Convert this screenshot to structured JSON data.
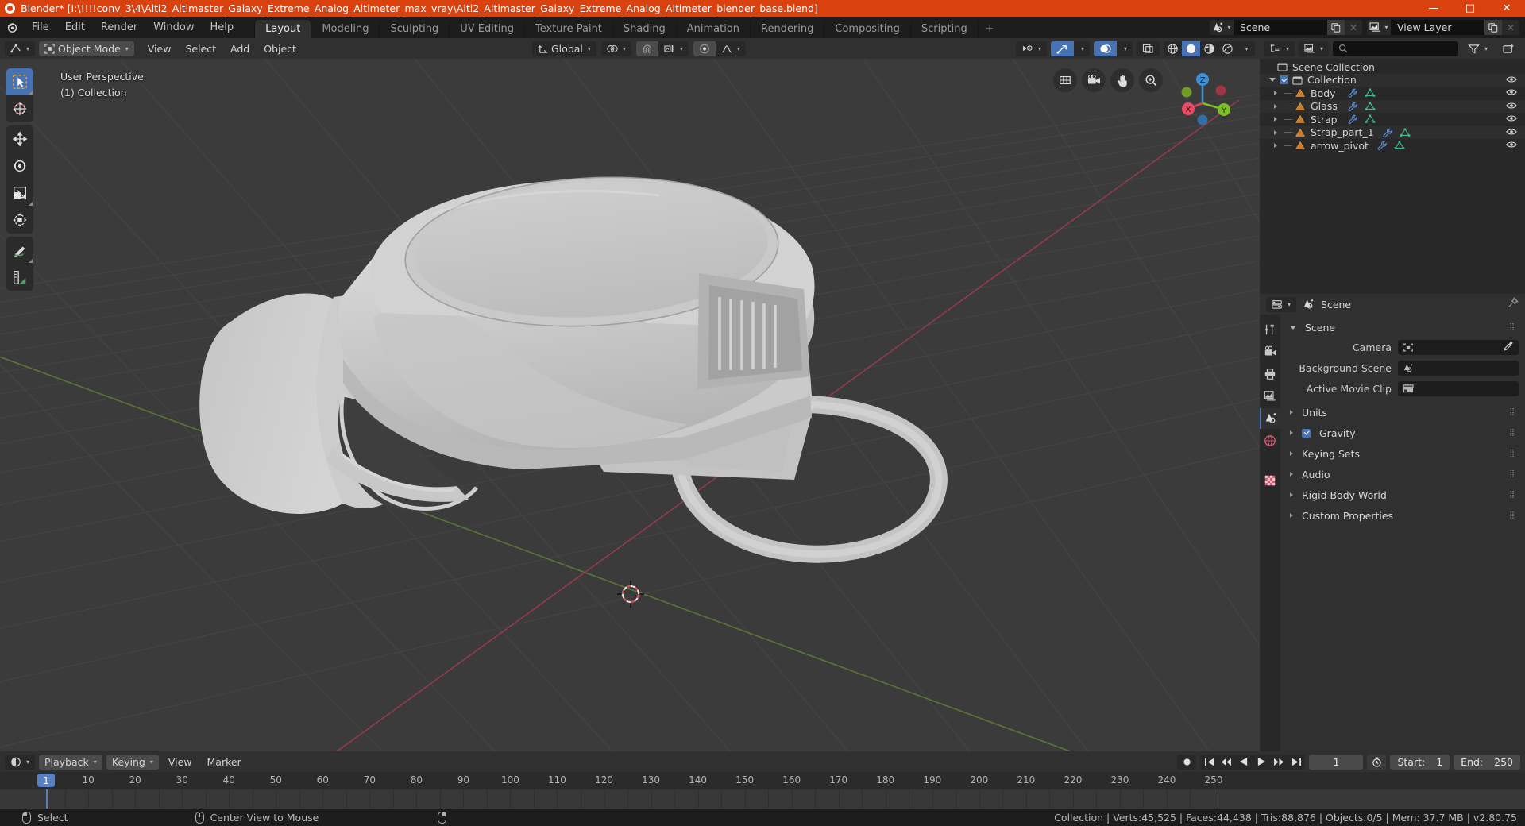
{
  "window": {
    "title": "Blender* [I:\\!!!!conv_3\\4\\Alti2_Altimaster_Galaxy_Extreme_Analog_Altimeter_max_vray\\Alti2_Altimaster_Galaxy_Extreme_Analog_Altimeter_blender_base.blend]",
    "minimize": "—",
    "maximize": "□",
    "close": "✕",
    "accent_color": "#d9410f"
  },
  "menus": [
    "File",
    "Edit",
    "Render",
    "Window",
    "Help"
  ],
  "workspaces": {
    "tabs": [
      "Layout",
      "Modeling",
      "Sculpting",
      "UV Editing",
      "Texture Paint",
      "Shading",
      "Animation",
      "Rendering",
      "Compositing",
      "Scripting"
    ],
    "active": "Layout",
    "add_label": "+"
  },
  "topbar_right": {
    "scene_name": "Scene",
    "view_layer_name": "View Layer",
    "scene_icon": "scene-data-icon",
    "view_layer_icon": "view-layer-icon",
    "copy_icon": "new-copy-icon",
    "close_icon": "x-icon"
  },
  "viewport_header": {
    "editor_type_icon": "editor-type-3dview-icon",
    "mode": "Object Mode",
    "mode_icon": "object-mode-icon",
    "menus": [
      "View",
      "Select",
      "Add",
      "Object"
    ],
    "transform_orientation": "Global",
    "transform_icon": "orientation-axis-icon",
    "snap_icon": "magnet-icon",
    "pivot_icon": "pivot-point-icon",
    "snap_target_icon": "snap-increment-icon",
    "proportional_icon": "proportional-edit-icon",
    "falloff_icon": "smooth-falloff-icon",
    "visibility_icon": "object-types-visibility-icon",
    "gizmo_icon": "gizmo-icon",
    "overlays_icon": "overlays-icon",
    "xray_icon": "toggle-xray-icon",
    "shading_modes": [
      "wireframe",
      "solid",
      "material-preview",
      "rendered"
    ],
    "shading_active": "solid"
  },
  "viewport": {
    "perspective_label": "User Perspective",
    "collection_label": "(1) Collection",
    "background_color": "#3b3b3b",
    "grid_color": "#4a4a4a",
    "x_axis_color": "#9c3a4a",
    "y_axis_color": "#5a7a35",
    "object_color": "#c9c9c9",
    "tools": [
      {
        "name": "tweak-select-box-tool",
        "active": true
      },
      {
        "name": "cursor-tool",
        "active": false
      },
      {
        "name": "move-tool",
        "active": false
      },
      {
        "name": "rotate-tool",
        "active": false
      },
      {
        "name": "scale-tool",
        "active": false
      },
      {
        "name": "transform-tool",
        "active": false
      },
      {
        "name": "annotate-tool",
        "active": false
      },
      {
        "name": "measure-tool",
        "active": false
      }
    ],
    "nav_buttons": [
      "zoom-region-icon",
      "camera-view-icon",
      "pan-view-icon",
      "zoom-view-icon"
    ],
    "gizmo_axes": [
      "Z",
      "Y",
      "X"
    ]
  },
  "outliner": {
    "display_mode_icon": "outliner-display-mode-icon",
    "filter_id_icon": "filter-id-icon",
    "search_placeholder": "",
    "search_icon": "search-icon",
    "filter_icon": "funnel-icon",
    "new_collection_icon": "new-collection-icon",
    "rows": [
      {
        "label": "Scene Collection",
        "icon": "collection-icon",
        "level": 0,
        "expander": "none",
        "checkbox": false,
        "eye": false,
        "modifier": false,
        "mesh": false
      },
      {
        "label": "Collection",
        "icon": "collection-icon",
        "level": 1,
        "expander": "down",
        "checkbox": true,
        "eye": true,
        "modifier": false,
        "mesh": false
      },
      {
        "label": "Body",
        "icon": "object-mesh-icon",
        "level": 2,
        "expander": "right",
        "checkbox": false,
        "eye": true,
        "modifier": true,
        "mesh": true
      },
      {
        "label": "Glass",
        "icon": "object-mesh-icon",
        "level": 2,
        "expander": "right",
        "checkbox": false,
        "eye": true,
        "modifier": true,
        "mesh": true
      },
      {
        "label": "Strap",
        "icon": "object-mesh-icon",
        "level": 2,
        "expander": "right",
        "checkbox": false,
        "eye": true,
        "modifier": true,
        "mesh": true
      },
      {
        "label": "Strap_part_1",
        "icon": "object-mesh-icon",
        "level": 2,
        "expander": "right",
        "checkbox": false,
        "eye": true,
        "modifier": true,
        "mesh": true
      },
      {
        "label": "arrow_pivot",
        "icon": "object-mesh-icon",
        "level": 2,
        "expander": "right",
        "checkbox": false,
        "eye": true,
        "modifier": true,
        "mesh": true
      }
    ]
  },
  "properties": {
    "editor_icon": "properties-editor-icon",
    "breadcrumb": "Scene",
    "breadcrumb_icon": "scene-properties-icon",
    "pin_icon": "pin-icon",
    "tabs": [
      {
        "name": "tool-tab",
        "icon": "tool-icon",
        "active": false
      },
      {
        "name": "render-tab",
        "icon": "render-camera-icon",
        "active": false
      },
      {
        "name": "output-tab",
        "icon": "printer-icon",
        "active": false
      },
      {
        "name": "view-layer-tab",
        "icon": "images-icon",
        "active": false
      },
      {
        "name": "scene-tab",
        "icon": "scene-cone-icon",
        "active": true
      },
      {
        "name": "world-tab",
        "icon": "world-globe-icon",
        "active": false
      },
      {
        "name": "texture-tab",
        "icon": "checker-texture-icon",
        "active": false
      }
    ],
    "panel_title": "Scene",
    "fields": [
      {
        "label": "Camera",
        "value": "",
        "icon": "camera-data-icon",
        "eyedropper": true
      },
      {
        "label": "Background Scene",
        "value": "",
        "icon": "scene-cone-icon",
        "eyedropper": false
      },
      {
        "label": "Active Movie Clip",
        "value": "",
        "icon": "movie-clip-icon",
        "eyedropper": false
      }
    ],
    "collapsed_panels": [
      {
        "label": "Units",
        "checkbox": false
      },
      {
        "label": "Gravity",
        "checkbox": true
      },
      {
        "label": "Keying Sets",
        "checkbox": false
      },
      {
        "label": "Audio",
        "checkbox": false
      },
      {
        "label": "Rigid Body World",
        "checkbox": false
      },
      {
        "label": "Custom Properties",
        "checkbox": false
      }
    ]
  },
  "timeline": {
    "editor_icon": "timeline-editor-icon",
    "menus": [
      "Playback",
      "Keying",
      "View",
      "Marker"
    ],
    "transport": [
      "jump-start-icon",
      "prev-keyframe-icon",
      "play-reverse-icon",
      "play-icon",
      "next-keyframe-icon",
      "jump-end-icon"
    ],
    "record_icon": "auto-keying-icon",
    "current_frame": "1",
    "timer_icon": "use-preview-range-icon",
    "start_label": "Start:",
    "start_value": "1",
    "end_label": "End:",
    "end_value": "250",
    "ticks": [
      10,
      20,
      30,
      40,
      50,
      60,
      70,
      80,
      90,
      100,
      110,
      120,
      130,
      140,
      150,
      160,
      170,
      180,
      190,
      200,
      210,
      220,
      230,
      240,
      250
    ],
    "playhead_frame": 1,
    "playhead_color": "#5680c2"
  },
  "statusbar": {
    "left_items": [
      {
        "mouse": "left",
        "label": "Select"
      },
      {
        "mouse": "middle",
        "label": "Center View to Mouse"
      },
      {
        "mouse": "right",
        "label": ""
      }
    ],
    "stats": "Collection | Verts:45,525 | Faces:44,438 | Tris:88,876 | Objects:0/5 | Mem: 37.7 MB | v2.80.75"
  }
}
